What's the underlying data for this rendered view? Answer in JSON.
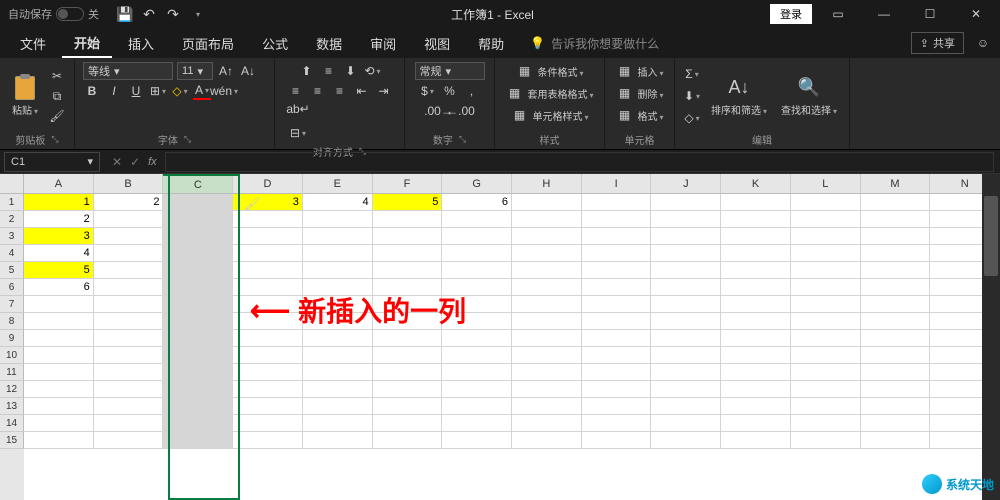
{
  "titlebar": {
    "autosave_label": "自动保存",
    "autosave_state": "关",
    "title": "工作簿1 - Excel",
    "login": "登录"
  },
  "menu": {
    "tabs": [
      "文件",
      "开始",
      "插入",
      "页面布局",
      "公式",
      "数据",
      "审阅",
      "视图",
      "帮助"
    ],
    "active_index": 1,
    "tell_me": "告诉我你想要做什么",
    "share": "共享"
  },
  "ribbon": {
    "clipboard": {
      "label": "剪贴板",
      "paste": "粘贴"
    },
    "font": {
      "label": "字体",
      "name": "等线",
      "size": "11",
      "buttons": [
        "B",
        "I",
        "U"
      ]
    },
    "alignment": {
      "label": "对齐方式"
    },
    "number": {
      "label": "数字",
      "format": "常规"
    },
    "styles": {
      "label": "样式",
      "cond": "条件格式",
      "table": "套用表格格式",
      "cell": "单元格样式"
    },
    "cells": {
      "label": "单元格",
      "insert": "插入",
      "delete": "删除",
      "format": "格式"
    },
    "editing": {
      "label": "编辑",
      "sort": "排序和筛选",
      "find": "查找和选择"
    }
  },
  "formula_bar": {
    "name_box": "C1",
    "fx": "fx"
  },
  "grid": {
    "columns": [
      "A",
      "B",
      "C",
      "D",
      "E",
      "F",
      "G",
      "H",
      "I",
      "J",
      "K",
      "L",
      "M",
      "N"
    ],
    "selected_col_index": 2,
    "row_count": 15,
    "cells": {
      "A1": {
        "v": "1",
        "yellow": true
      },
      "B1": {
        "v": "2"
      },
      "D1": {
        "v": "3",
        "yellow": true
      },
      "E1": {
        "v": "4"
      },
      "F1": {
        "v": "5",
        "yellow": true
      },
      "G1": {
        "v": "6"
      },
      "A2": {
        "v": "2"
      },
      "A3": {
        "v": "3",
        "yellow": true
      },
      "A4": {
        "v": "4"
      },
      "A5": {
        "v": "5",
        "yellow": true
      },
      "A6": {
        "v": "6"
      }
    }
  },
  "annotation": {
    "text": "新插入的一列"
  },
  "watermark": {
    "text": "系统天地"
  }
}
